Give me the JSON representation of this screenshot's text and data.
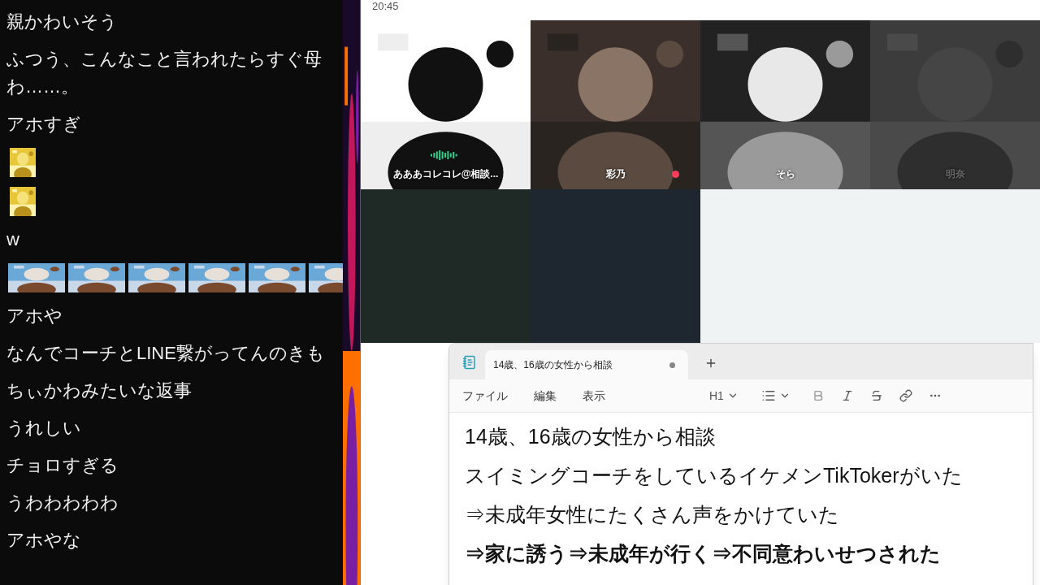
{
  "chat": [
    {
      "kind": "text",
      "lines": [
        "親かわいそう"
      ]
    },
    {
      "kind": "text",
      "lines": [
        "ふつう、こんなこと言われたらすぐ母",
        "わ……。"
      ]
    },
    {
      "kind": "text",
      "lines": [
        "アホすぎ"
      ]
    },
    {
      "kind": "emote"
    },
    {
      "kind": "emote"
    },
    {
      "kind": "text",
      "lines": [
        "w"
      ]
    },
    {
      "kind": "emote_row"
    },
    {
      "kind": "text",
      "lines": [
        "アホや"
      ]
    },
    {
      "kind": "text",
      "lines": [
        "なんでコーチとLINE繋がってんのきも"
      ]
    },
    {
      "kind": "text",
      "lines": [
        "ちぃかわみたいな返事"
      ]
    },
    {
      "kind": "text",
      "lines": [
        "うれしい"
      ]
    },
    {
      "kind": "text",
      "lines": [
        "チョロすぎる"
      ]
    },
    {
      "kind": "text",
      "lines": [
        "うわわわわわ"
      ]
    },
    {
      "kind": "text",
      "lines": [
        "アホやな"
      ]
    }
  ],
  "call": {
    "time": "20:45",
    "tiles": [
      {
        "kind": "video",
        "name": "あああコレコレ@相談...",
        "speaking": true,
        "muted": false,
        "dim": false
      },
      {
        "kind": "video",
        "name": "彩乃",
        "speaking": false,
        "muted": true,
        "dim": false
      },
      {
        "kind": "video",
        "name": "そら",
        "speaking": false,
        "muted": false,
        "dim": false
      },
      {
        "kind": "video",
        "name": "明奈",
        "speaking": false,
        "muted": false,
        "dim": true
      },
      {
        "kind": "dark",
        "color": "#1f2a26"
      },
      {
        "kind": "dark",
        "color": "#1e2630"
      },
      {
        "kind": "empty"
      },
      {
        "kind": "empty"
      }
    ]
  },
  "notepad": {
    "tab": {
      "title": "14歳、16歳の女性から相談",
      "unsaved": true
    },
    "menu": [
      "ファイル",
      "編集",
      "表示"
    ],
    "heading_button": "H1",
    "lines": [
      {
        "text": "14歳、16歳の女性から相談",
        "bold": false
      },
      {
        "text": "スイミングコーチをしているイケメンTikTokerがいた",
        "bold": false
      },
      {
        "text": "⇒未成年女性にたくさん声をかけていた",
        "bold": false
      },
      {
        "text": "⇒家に誘う⇒未成年が行く⇒不同意わいせつされた",
        "bold": true
      }
    ]
  }
}
